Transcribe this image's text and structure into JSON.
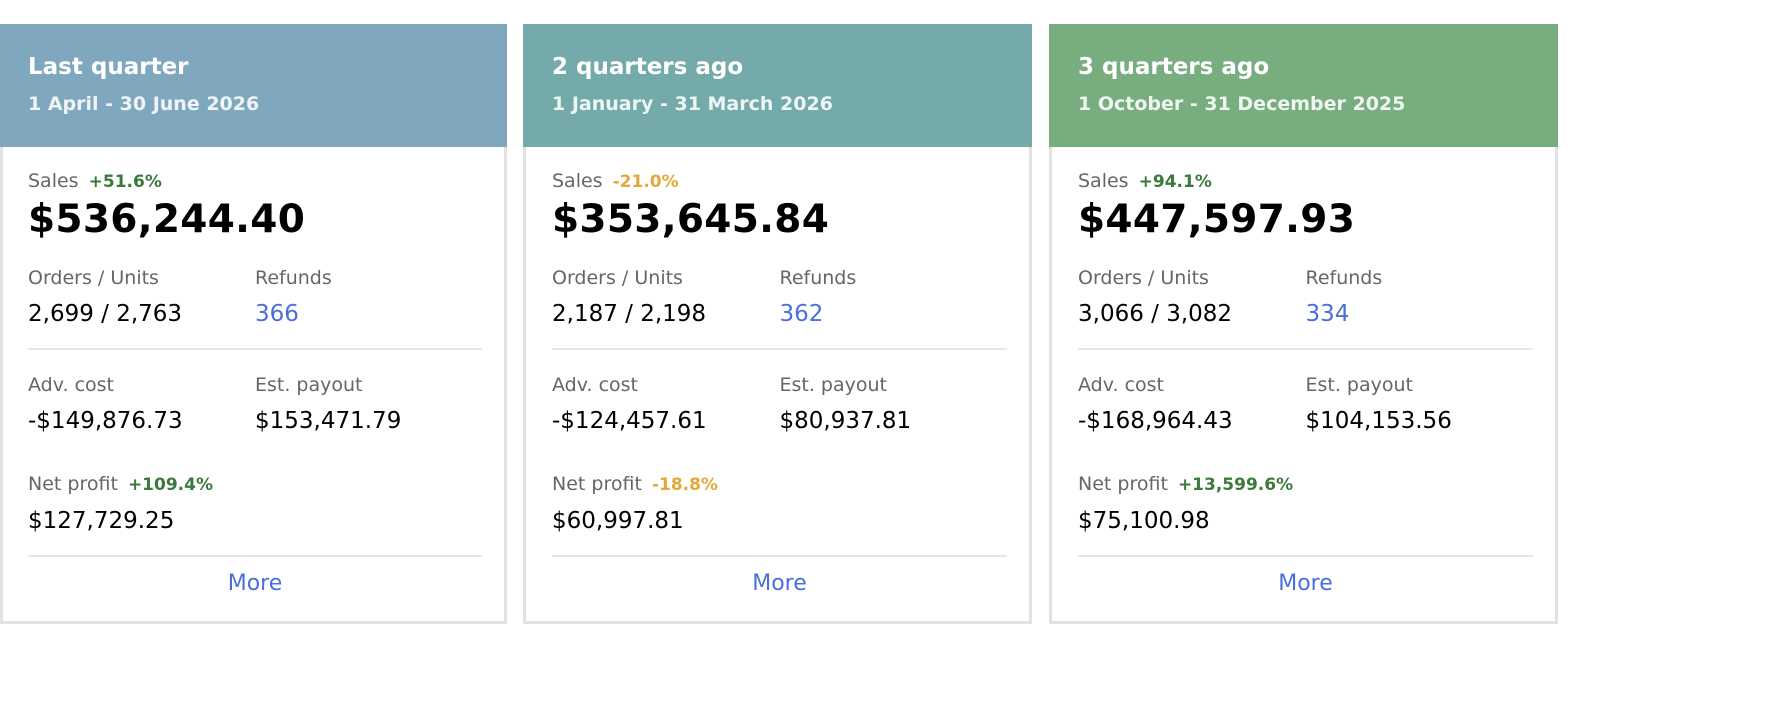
{
  "colors": {
    "header": [
      "#7fa8be",
      "#74aaaa",
      "#78ad7f"
    ],
    "positive": "#3c7a3c",
    "negative": "#e4a83a",
    "link": "#4a6fd8"
  },
  "cards": [
    {
      "title": "Last quarter",
      "period": "1 April - 30 June 2026",
      "sales_label": "Sales",
      "sales_delta": "+51.6%",
      "sales_delta_dir": "positive",
      "sales_value": "$536,244.40",
      "orders_label": "Orders / Units",
      "orders_value": "2,699 / 2,763",
      "refunds_label": "Refunds",
      "refunds_value": "366",
      "adv_label": "Adv. cost",
      "adv_value": "-$149,876.73",
      "payout_label": "Est. payout",
      "payout_value": "$153,471.79",
      "profit_label": "Net profit",
      "profit_delta": "+109.4%",
      "profit_delta_dir": "positive",
      "profit_value": "$127,729.25",
      "more_label": "More"
    },
    {
      "title": "2 quarters ago",
      "period": "1 January - 31 March 2026",
      "sales_label": "Sales",
      "sales_delta": "-21.0%",
      "sales_delta_dir": "negative",
      "sales_value": "$353,645.84",
      "orders_label": "Orders / Units",
      "orders_value": "2,187 / 2,198",
      "refunds_label": "Refunds",
      "refunds_value": "362",
      "adv_label": "Adv. cost",
      "adv_value": "-$124,457.61",
      "payout_label": "Est. payout",
      "payout_value": "$80,937.81",
      "profit_label": "Net profit",
      "profit_delta": "-18.8%",
      "profit_delta_dir": "negative",
      "profit_value": "$60,997.81",
      "more_label": "More"
    },
    {
      "title": "3 quarters ago",
      "period": "1 October - 31 December 2025",
      "sales_label": "Sales",
      "sales_delta": "+94.1%",
      "sales_delta_dir": "positive",
      "sales_value": "$447,597.93",
      "orders_label": "Orders / Units",
      "orders_value": "3,066 / 3,082",
      "refunds_label": "Refunds",
      "refunds_value": "334",
      "adv_label": "Adv. cost",
      "adv_value": "-$168,964.43",
      "payout_label": "Est. payout",
      "payout_value": "$104,153.56",
      "profit_label": "Net profit",
      "profit_delta": "+13,599.6%",
      "profit_delta_dir": "positive",
      "profit_value": "$75,100.98",
      "more_label": "More"
    }
  ]
}
